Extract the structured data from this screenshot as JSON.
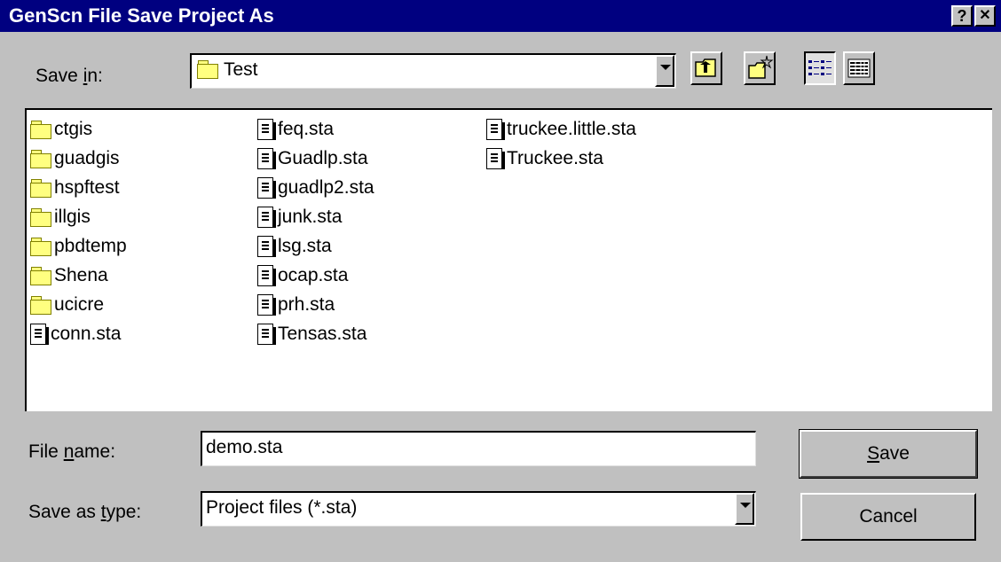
{
  "window": {
    "title": "GenScn File Save Project As",
    "help_btn": "?",
    "close_btn": "✕"
  },
  "save_in": {
    "label": "Save in:",
    "value": "Test",
    "folder_icon": "open-folder-icon"
  },
  "toolbar": {
    "up_icon": "up-one-level-icon",
    "new_folder_icon": "new-folder-icon",
    "list_icon": "list-view-icon",
    "details_icon": "details-view-icon"
  },
  "files": {
    "col1": [
      {
        "name": "ctgis",
        "type": "folder"
      },
      {
        "name": "guadgis",
        "type": "folder"
      },
      {
        "name": "hspftest",
        "type": "folder"
      },
      {
        "name": "illgis",
        "type": "folder"
      },
      {
        "name": "pbdtemp",
        "type": "folder"
      },
      {
        "name": "Shena",
        "type": "folder"
      },
      {
        "name": "ucicre",
        "type": "folder"
      },
      {
        "name": "conn.sta",
        "type": "file"
      }
    ],
    "col2": [
      {
        "name": "feq.sta",
        "type": "file"
      },
      {
        "name": "Guadlp.sta",
        "type": "file"
      },
      {
        "name": "guadlp2.sta",
        "type": "file"
      },
      {
        "name": "junk.sta",
        "type": "file"
      },
      {
        "name": "lsg.sta",
        "type": "file"
      },
      {
        "name": "ocap.sta",
        "type": "file"
      },
      {
        "name": "prh.sta",
        "type": "file"
      },
      {
        "name": "Tensas.sta",
        "type": "file"
      }
    ],
    "col3": [
      {
        "name": "truckee.little.sta",
        "type": "file"
      },
      {
        "name": "Truckee.sta",
        "type": "file"
      }
    ]
  },
  "file_name": {
    "label": "File name:",
    "value": "demo.sta"
  },
  "save_type": {
    "label": "Save as type:",
    "value": "Project files (*.sta)"
  },
  "buttons": {
    "save": "Save",
    "cancel": "Cancel"
  }
}
